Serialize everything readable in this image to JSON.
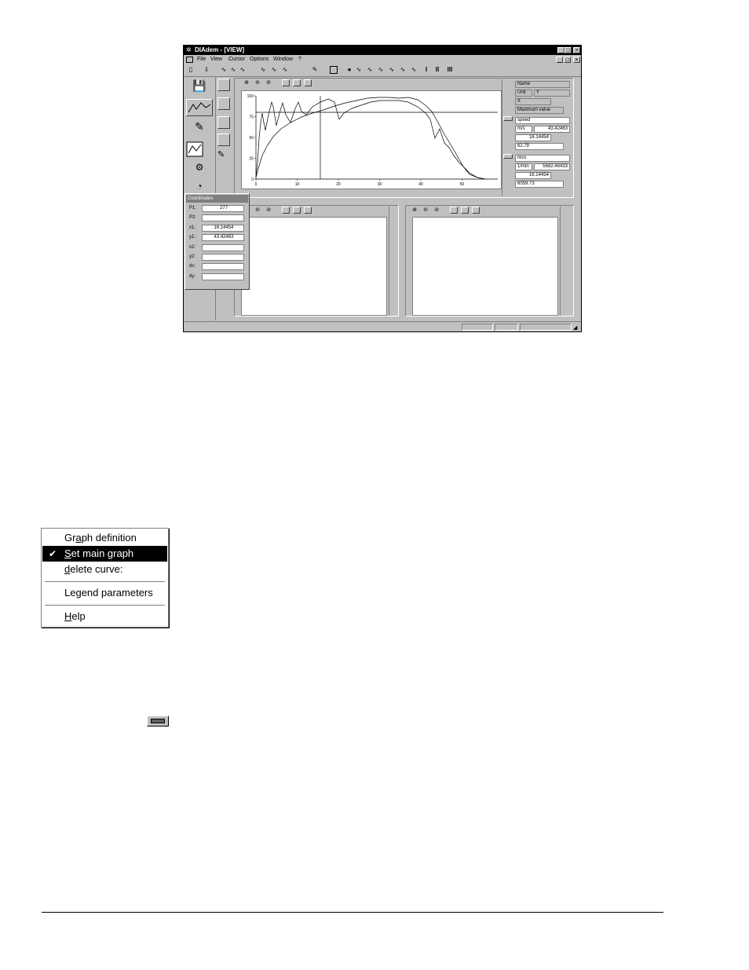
{
  "window": {
    "title": "DIAdem - [VIEW]",
    "menu": [
      "File",
      "View",
      "Cursor",
      "Options",
      "Window",
      "?"
    ],
    "controls": {
      "minimize": "_",
      "maximize": "□",
      "close": "×"
    }
  },
  "coordinates": {
    "title": "Coordinates",
    "rows": [
      {
        "label": "P1:",
        "value": "277"
      },
      {
        "label": "P2:",
        "value": ""
      },
      {
        "label": "x1:",
        "value": "16.14454"
      },
      {
        "label": "y1:",
        "value": "43.42463"
      },
      {
        "label": "x2:",
        "value": ""
      },
      {
        "label": "y2:",
        "value": ""
      },
      {
        "label": "dx:",
        "value": ""
      },
      {
        "label": "dy:",
        "value": ""
      }
    ]
  },
  "legend": {
    "header": {
      "name": "Name",
      "unit": "Unit",
      "y": "Y",
      "x": "X",
      "max": "Maximum value"
    },
    "curve1": {
      "name": "speed",
      "unit": "m/s",
      "y": "43.42463",
      "x": "16.14454",
      "max": "62.78"
    },
    "curve2": {
      "name": "revs",
      "unit": "1/min",
      "y": "5682.46433",
      "x": "16.14454",
      "max": "6059.73"
    }
  },
  "graph": {
    "y_ticks": [
      "100",
      "75",
      "50",
      "25",
      "0"
    ],
    "x_ticks": [
      "0",
      "10",
      "20",
      "30",
      "40",
      "50"
    ]
  },
  "context_menu": {
    "items": [
      {
        "label": "Graph definition",
        "checked": false
      },
      {
        "label": "Set main graph",
        "checked": true
      },
      {
        "label": "delete curve:",
        "checked": false
      },
      {
        "label": "Legend parameters",
        "checked": false
      },
      {
        "label": "Help",
        "checked": false
      }
    ]
  },
  "icons": {
    "graph_button": "legend-toggle-button-icon"
  }
}
